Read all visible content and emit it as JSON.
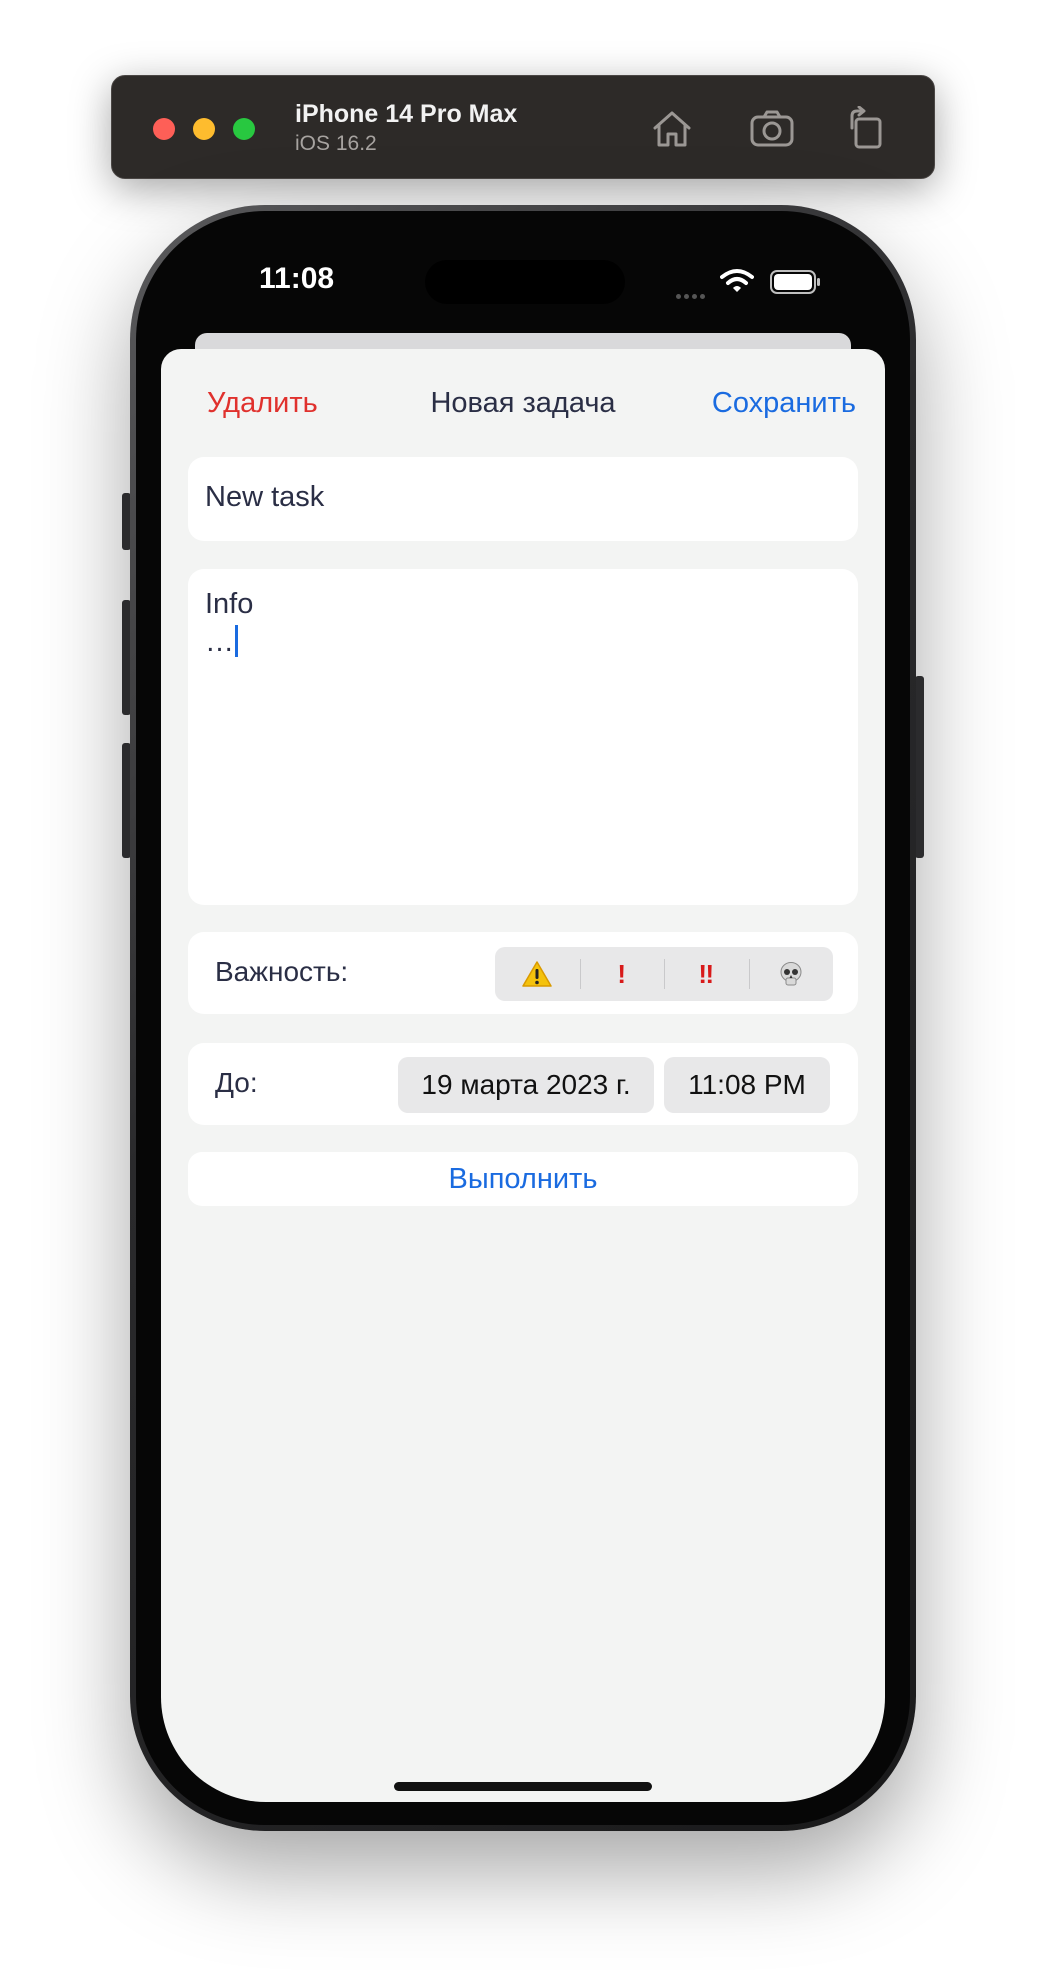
{
  "simulator": {
    "device_name": "iPhone 14 Pro Max",
    "os_version": "iOS 16.2",
    "toolbar_icons": [
      "home-icon",
      "screenshot-icon",
      "rotate-icon"
    ]
  },
  "status_bar": {
    "time": "11:08",
    "icons": [
      "cellular-icon",
      "wifi-icon",
      "battery-icon"
    ]
  },
  "nav": {
    "delete_label": "Удалить",
    "title": "Новая задача",
    "save_label": "Сохранить"
  },
  "form": {
    "title_value": "New task",
    "info_value": "Info\n…",
    "priority": {
      "label": "Важность:",
      "options": [
        "⚠️",
        "!",
        "‼",
        "💀"
      ]
    },
    "due": {
      "label": "До:",
      "date": "19 марта 2023 г.",
      "time": "11:08 PM"
    },
    "complete_label": "Выполнить"
  },
  "colors": {
    "destructive": "#e0312d",
    "accent": "#1a6be0",
    "background": "#f3f4f3",
    "text": "#2a2e45"
  }
}
